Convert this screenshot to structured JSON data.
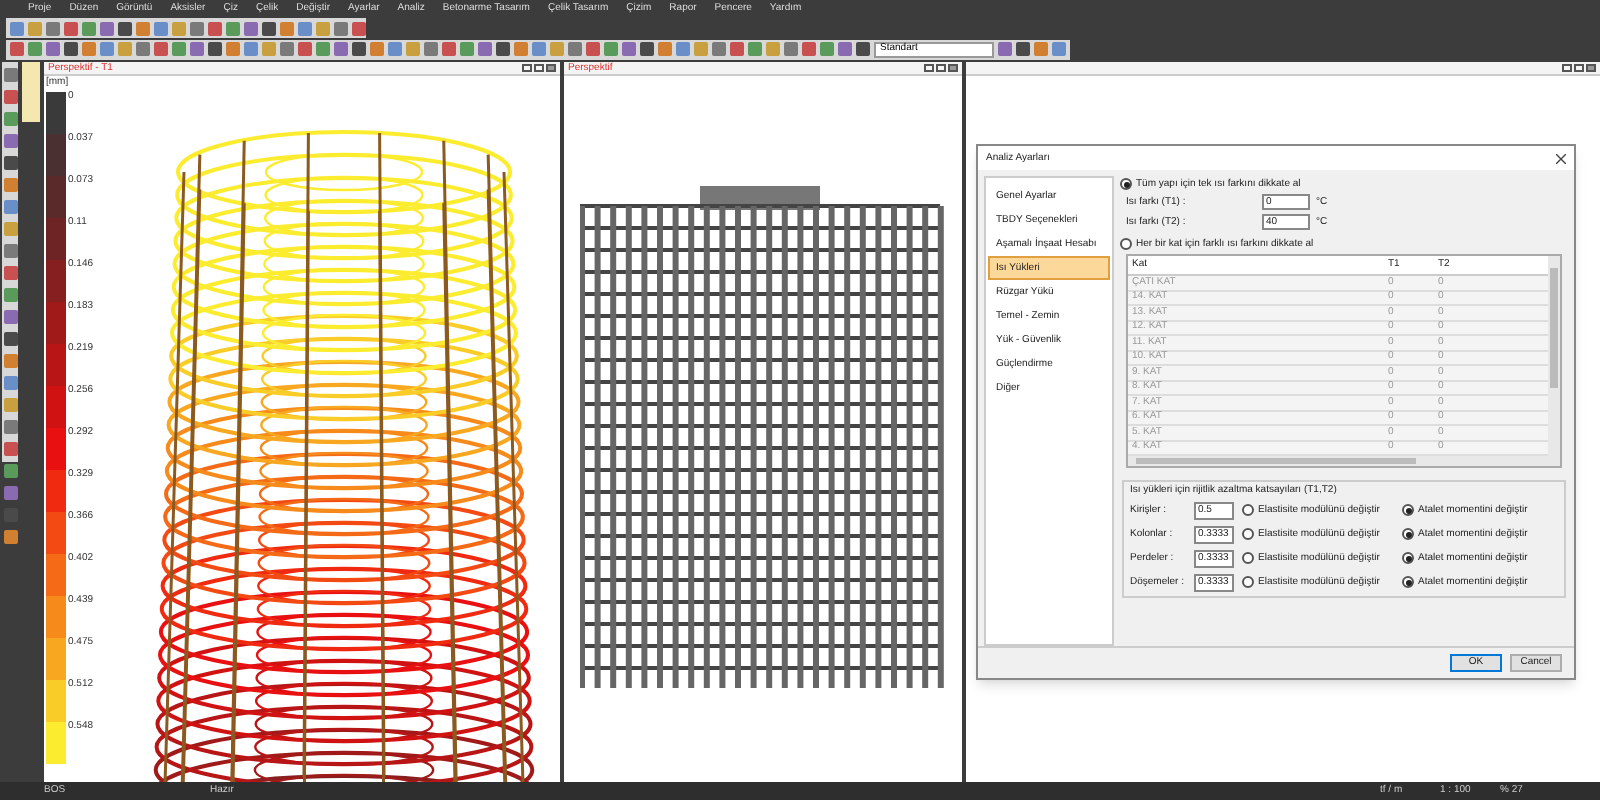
{
  "menu": [
    "Proje",
    "Düzen",
    "Görüntü",
    "Aksisler",
    "Çiz",
    "Çelik",
    "Değiştir",
    "Ayarlar",
    "Analiz",
    "Betonarme Tasarım",
    "Çelik Tasarım",
    "Çizim",
    "Rapor",
    "Pencere",
    "Yardım"
  ],
  "style_select": {
    "value": "Standart"
  },
  "viewports": [
    {
      "title": "Perspektif - T1",
      "kind": "colored"
    },
    {
      "title": "Perspektif",
      "kind": "gray"
    },
    {
      "kind": "empty"
    }
  ],
  "legend": {
    "unit": "[mm]",
    "items": [
      {
        "label": "0",
        "color": "#3a3a3a"
      },
      {
        "label": "0.037",
        "color": "#4a3030"
      },
      {
        "label": "0.073",
        "color": "#5a2a2a"
      },
      {
        "label": "0.11",
        "color": "#6e2424"
      },
      {
        "label": "0.146",
        "color": "#861f1f"
      },
      {
        "label": "0.183",
        "color": "#a01a1a"
      },
      {
        "label": "0.219",
        "color": "#b81616"
      },
      {
        "label": "0.256",
        "color": "#d01212"
      },
      {
        "label": "0.292",
        "color": "#e81010"
      },
      {
        "label": "0.329",
        "color": "#f02a10"
      },
      {
        "label": "0.366",
        "color": "#f24a12"
      },
      {
        "label": "0.402",
        "color": "#f46a16"
      },
      {
        "label": "0.439",
        "color": "#f68a1a"
      },
      {
        "label": "0.475",
        "color": "#f8a820"
      },
      {
        "label": "0.512",
        "color": "#facc28"
      },
      {
        "label": "0.548",
        "color": "#fcec30"
      }
    ]
  },
  "dialog": {
    "title": "Analiz Ayarları",
    "sidebar": [
      {
        "label": "Genel Ayarlar",
        "selected": false
      },
      {
        "label": "TBDY Seçenekleri",
        "selected": false
      },
      {
        "label": "Aşamalı İnşaat Hesabı",
        "selected": false
      },
      {
        "label": "Isı Yükleri",
        "selected": true
      },
      {
        "label": "Rüzgar Yükü",
        "selected": false
      },
      {
        "label": "Temel - Zemin",
        "selected": false
      },
      {
        "label": "Yük - Güvenlik",
        "selected": false
      },
      {
        "label": "Güçlendirme",
        "selected": false
      },
      {
        "label": "Diğer",
        "selected": false
      }
    ],
    "mode_single": {
      "label": "Tüm yapı için tek ısı farkını dikkate al",
      "selected": true
    },
    "fields": [
      {
        "label": "Isı farkı  (T1) :",
        "value": "0",
        "unit": "°C"
      },
      {
        "label": "Isı farkı  (T2) :",
        "value": "40",
        "unit": "°C"
      }
    ],
    "mode_per_floor": {
      "label": "Her bir kat için farklı ısı farkını dikkate al",
      "selected": false
    },
    "table": {
      "columns": [
        "Kat",
        "T1",
        "T2"
      ],
      "rows": [
        [
          "ÇATI KAT",
          "0",
          "0"
        ],
        [
          "14. KAT",
          "0",
          "0"
        ],
        [
          "13. KAT",
          "0",
          "0"
        ],
        [
          "12. KAT",
          "0",
          "0"
        ],
        [
          "11. KAT",
          "0",
          "0"
        ],
        [
          "10. KAT",
          "0",
          "0"
        ],
        [
          "9. KAT",
          "0",
          "0"
        ],
        [
          "8. KAT",
          "0",
          "0"
        ],
        [
          "7. KAT",
          "0",
          "0"
        ],
        [
          "6. KAT",
          "0",
          "0"
        ],
        [
          "5. KAT",
          "0",
          "0"
        ],
        [
          "4. KAT",
          "0",
          "0"
        ]
      ]
    },
    "factors": {
      "title": "Isı yükleri için rijitlik azaltma katsayıları (T1,T2)",
      "rows": [
        {
          "label": "Kirişler :",
          "value": "0.5",
          "options": [
            {
              "label": "Elastisite modülünü değiştir",
              "selected": false
            },
            {
              "label": "Atalet momentini değiştir",
              "selected": true
            }
          ]
        },
        {
          "label": "Kolonlar :",
          "value": "0.3333",
          "options": [
            {
              "label": "Elastisite modülünü değiştir",
              "selected": false
            },
            {
              "label": "Atalet momentini değiştir",
              "selected": true
            }
          ]
        },
        {
          "label": "Perdeler :",
          "value": "0.3333",
          "options": [
            {
              "label": "Elastisite modülünü değiştir",
              "selected": false
            },
            {
              "label": "Atalet momentini değiştir",
              "selected": true
            }
          ]
        },
        {
          "label": "Döşemeler :",
          "value": "0.3333",
          "options": [
            {
              "label": "Elastisite modülünü değiştir",
              "selected": false
            },
            {
              "label": "Atalet momentini değiştir",
              "selected": true
            }
          ]
        }
      ]
    },
    "buttons": [
      "OK",
      "Cancel"
    ]
  },
  "status_bar": [
    "BOS",
    "Hazır",
    "tf / m",
    "1 : 100",
    "% 27"
  ]
}
